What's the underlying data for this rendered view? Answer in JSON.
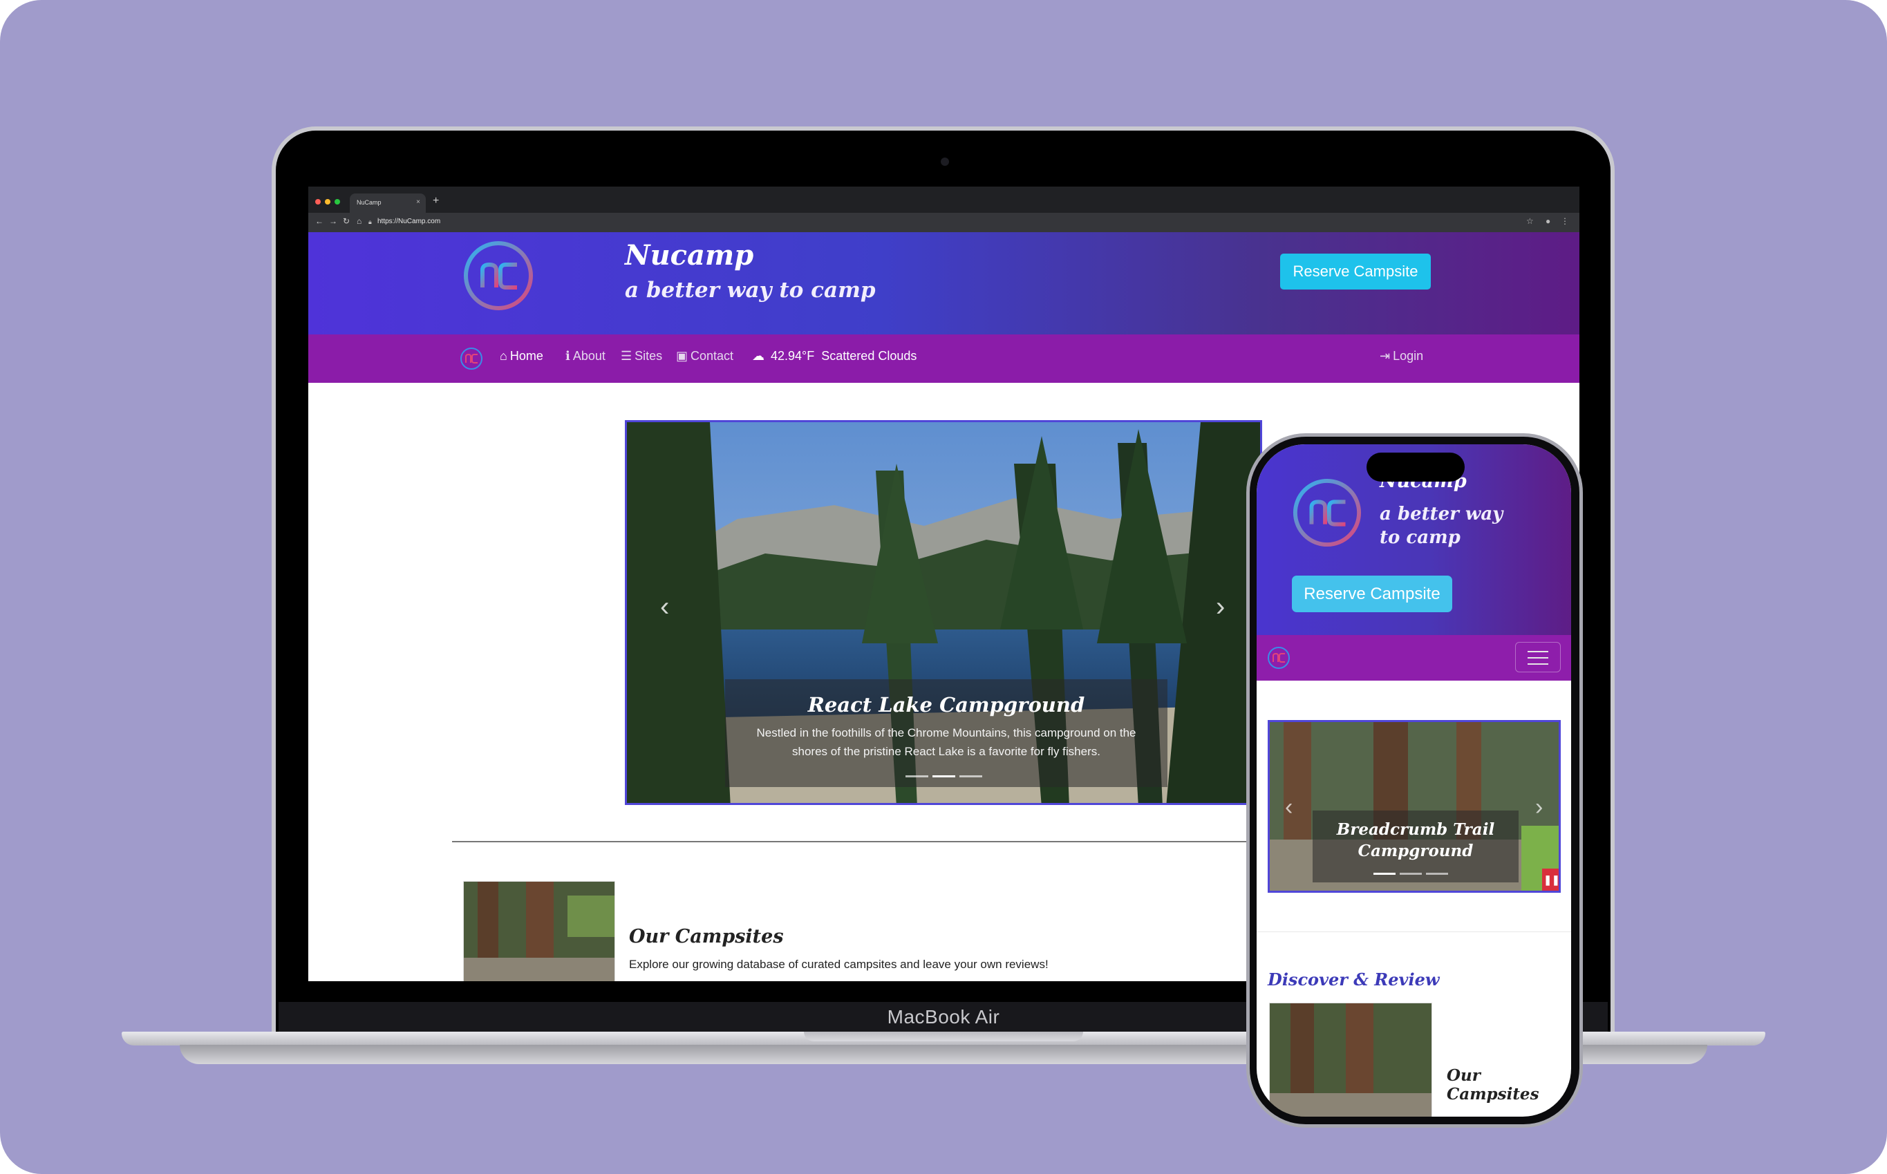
{
  "colors": {
    "background": "#a09bcb",
    "header_start": "#4f33d9",
    "header_end": "#5e1c86",
    "navbar": "#8b1ca9",
    "reserve_button": "#1ec2eb",
    "carousel_border": "#5046d8",
    "pause_button": "#d92f3d",
    "discover_heading": "#3c3ab8"
  },
  "browser": {
    "tab_title": "NuCamp",
    "tab_close": "×",
    "new_tab": "+",
    "url": "https://NuCamp.com"
  },
  "site": {
    "brand_title": "Nucamp",
    "tagline": "a better way to camp",
    "reserve_label": "Reserve Campsite",
    "logo_icon": "nucamp-logo-icon",
    "nav": [
      {
        "label": "Home",
        "icon": "home-icon",
        "active": true
      },
      {
        "label": "About",
        "icon": "info-icon",
        "active": false
      },
      {
        "label": "Sites",
        "icon": "list-icon",
        "active": false
      },
      {
        "label": "Contact",
        "icon": "address-card-icon",
        "active": false
      }
    ],
    "weather": {
      "icon": "cloud-icon",
      "temperature": "42.94°F",
      "condition": "Scattered Clouds"
    },
    "login_label": "Login",
    "carousel": {
      "title": "React Lake Campground",
      "text": "Nestled in the foothills of the Chrome Mountains, this campground on the shores of the pristine React Lake is a favorite for fly fishers.",
      "slide_count": 3,
      "active_slide": 2
    },
    "card": {
      "title": "Our Campsites",
      "text": "Explore our growing database of curated campsites and leave your own reviews!"
    }
  },
  "device": {
    "laptop_label": "MacBook Air"
  },
  "phone": {
    "brand_title": "Nucamp",
    "tagline": "a better way to camp",
    "reserve_label": "Reserve Campsite",
    "carousel": {
      "title": "Breadcrumb Trail Campground",
      "slide_count": 3,
      "active_slide": 1
    },
    "section_heading": "Discover & Review",
    "card_title": "Our Campsites"
  }
}
